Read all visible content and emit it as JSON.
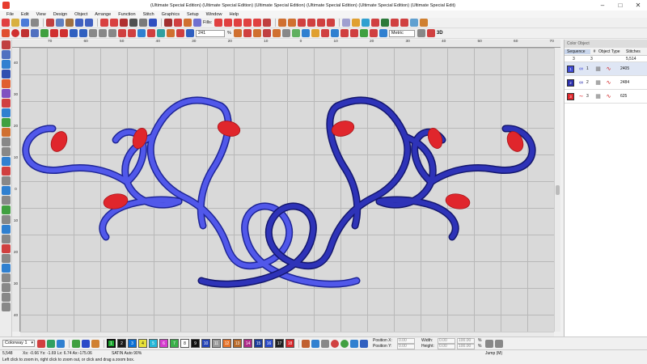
{
  "window": {
    "title": "(Ultimate Special Edition) (Ultimate Special Edition) (Ultimate Special Edition) (Ultimate Special Edition) (Ultimate Special Edition) (Ultimate Special Edit)",
    "controls": [
      "minimize-icon",
      "maximize-icon",
      "close-icon"
    ]
  },
  "menu": [
    "File",
    "Edit",
    "View",
    "Design",
    "Object",
    "Arrange",
    "Function",
    "Stitch",
    "Graphics",
    "Setup",
    "Window",
    "Help"
  ],
  "toolbar": {
    "fills_label": "Fills:",
    "zoom_value": "241",
    "zoom_unit": "%",
    "units_value": "Metric",
    "view3d_label": "3D"
  },
  "document_tab": "Value_5",
  "ruler": {
    "top": [
      "70",
      "60",
      "50",
      "40",
      "30",
      "20",
      "10",
      "0",
      "10",
      "20",
      "30",
      "40",
      "50",
      "60",
      "70"
    ],
    "left": [
      "40",
      "30",
      "20",
      "10",
      "0",
      "10",
      "20",
      "30",
      "40"
    ]
  },
  "objects_panel": {
    "title": "Color Object",
    "headers": {
      "sequence": "Sequence",
      "number": "#",
      "type": "Object Type",
      "stitches": "Stitches"
    },
    "total": {
      "count": "3",
      "sub": "3",
      "stitches": "5,514"
    },
    "rows": [
      {
        "id": "1",
        "stitches": "2405",
        "color": "#3f4ad6"
      },
      {
        "id": "2",
        "stitches": "2484",
        "color": "#2b2fae"
      },
      {
        "id": "3",
        "stitches": "625",
        "color": "#e0262c"
      }
    ]
  },
  "colorway": {
    "selected": "Colorway 1",
    "chips": [
      {
        "label": "1",
        "color": "#1aa82e"
      },
      {
        "label": "2",
        "color": "#1b1b1b"
      },
      {
        "label": "3",
        "color": "#0a6fd6"
      },
      {
        "label": "4",
        "color": "#e8e23a"
      },
      {
        "label": "5",
        "color": "#26b8d8"
      },
      {
        "label": "6",
        "color": "#d63ccf"
      },
      {
        "label": "7",
        "color": "#3ab04a"
      },
      {
        "label": "8",
        "color": "#ffffff"
      },
      {
        "label": "9",
        "color": "#111111"
      },
      {
        "label": "10",
        "color": "#2444b8"
      },
      {
        "label": "11",
        "color": "#9a9a9a"
      },
      {
        "label": "12",
        "color": "#e8742a"
      },
      {
        "label": "13",
        "color": "#b86a2a"
      },
      {
        "label": "14",
        "color": "#b02a8a"
      },
      {
        "label": "15",
        "color": "#1a3a9a"
      },
      {
        "label": "16",
        "color": "#2a4ac8"
      },
      {
        "label": "17",
        "color": "#202020"
      },
      {
        "label": "18",
        "color": "#d8262a"
      }
    ]
  },
  "position": {
    "x_label": "Position X:",
    "y_label": "Position Y:",
    "width_label": "Width:",
    "height_label": "Height:",
    "x_value": "0.00",
    "y_value": "0.00",
    "width_value": "0.00",
    "height_value": "0.00",
    "pct1": "100.00",
    "pct2": "100.00",
    "pct_unit": "%"
  },
  "status": {
    "stitch_count": "5,548",
    "coords": "Xs: -0.66 Ys: -1.69 Lx: 6.74 Ax:-175.06",
    "mode": "SATIN Auto 90%",
    "jump": "Jump (M)",
    "hint": "Left click to zoom in, right click to zoom out, or click and drag a zoom box."
  },
  "colors": {
    "stitch_blue_light": "#3f4ad6",
    "stitch_blue_dark": "#2b2fae",
    "stitch_red": "#e0262c"
  }
}
